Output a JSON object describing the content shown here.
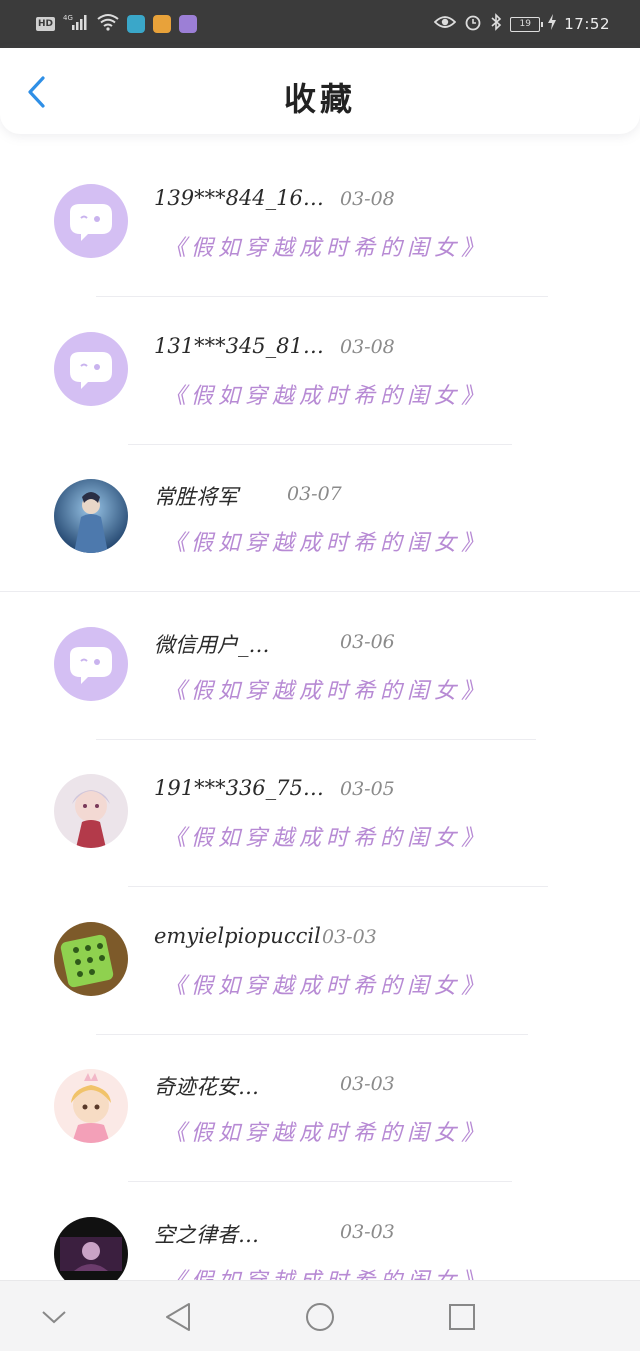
{
  "status_bar": {
    "network": "HD",
    "signal": "4G",
    "battery": "19",
    "time": "17:52"
  },
  "header": {
    "title": "收藏"
  },
  "colors": {
    "accent_blue": "#2f8fe6",
    "book_purple": "#b78ad4",
    "default_avatar": "#d4bff3"
  },
  "favorites": [
    {
      "name": "139***844_16…",
      "date": "03-08",
      "book": "《假如穿越成时希的闺女》",
      "avatar": "default-chat-icon"
    },
    {
      "name": "131***345_81…",
      "date": "03-08",
      "book": "《假如穿越成时希的闺女》",
      "avatar": "default-chat-icon"
    },
    {
      "name": "常胜将军",
      "date": "03-07",
      "book": "《假如穿越成时希的闺女》",
      "avatar": "warrior-photo"
    },
    {
      "name": "微信用户_…",
      "date": "03-06",
      "book": "《假如穿越成时希的闺女》",
      "avatar": "default-chat-icon"
    },
    {
      "name": "191***336_75…",
      "date": "03-05",
      "book": "《假如穿越成时希的闺女》",
      "avatar": "anime-girl-photo"
    },
    {
      "name": "emyielpiopuccil",
      "date": "03-03",
      "book": "《假如穿越成时希的闺女》",
      "avatar": "green-dice-photo"
    },
    {
      "name": "奇迹花安…",
      "date": "03-03",
      "book": "《假如穿越成时希的闺女》",
      "avatar": "chibi-princess-photo"
    },
    {
      "name": "空之律者…",
      "date": "03-03",
      "book": "《假如穿越成时希的闺女》",
      "avatar": "dark-anime-photo"
    }
  ]
}
